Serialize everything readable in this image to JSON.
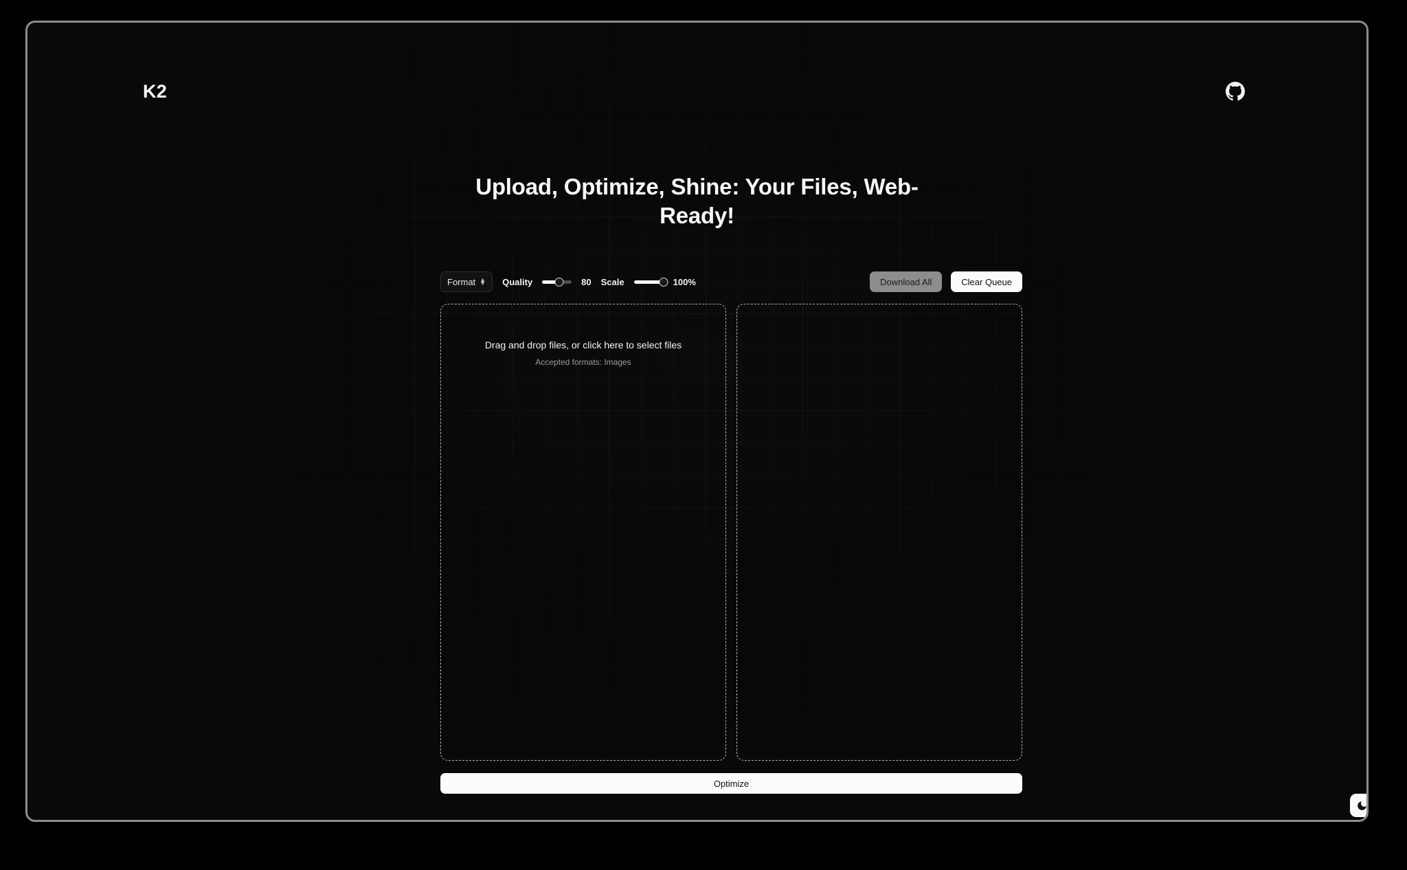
{
  "header": {
    "brand": "K2",
    "github_icon": "github-icon"
  },
  "hero": {
    "heading": "Upload, Optimize, Shine: Your Files, Web-Ready!"
  },
  "toolbar": {
    "format": {
      "label": "Format",
      "chevron_icon": "chevron-updown-icon"
    },
    "quality": {
      "label": "Quality",
      "value": "80",
      "percent": 58,
      "min": 0,
      "max": 100
    },
    "scale": {
      "label": "Scale",
      "value": "100%",
      "percent": 100,
      "min": 0,
      "max": 100
    },
    "download_all_label": "Download All",
    "clear_queue_label": "Clear Queue"
  },
  "dropzone": {
    "primary": "Drag and drop files, or click here to select files",
    "secondary": "Accepted formats: Images"
  },
  "actions": {
    "optimize_label": "Optimize"
  },
  "theme_toggle": {
    "icon": "moon-icon"
  },
  "colors": {
    "page_background": "#0b0b0b",
    "frame_border": "#8e8e8e",
    "accent_white": "#fbfbfb",
    "disabled_gray": "#8d8d8d",
    "dashed_border": "#b4b4b4",
    "muted_text": "#9b9b9b"
  }
}
